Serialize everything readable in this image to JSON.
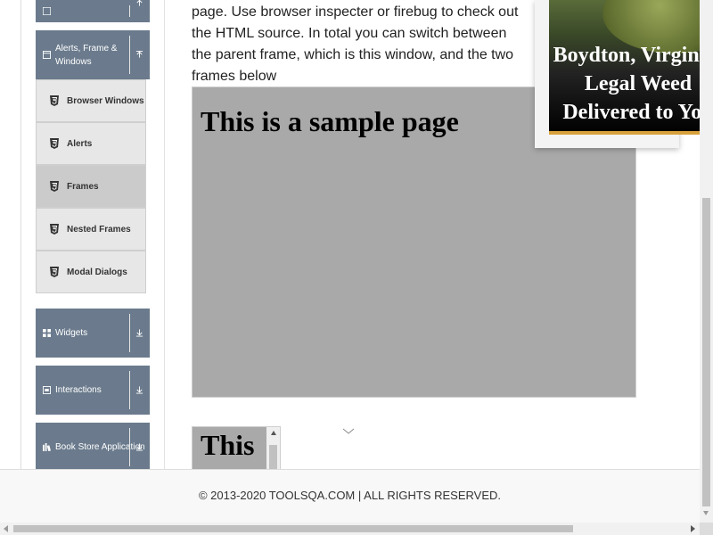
{
  "sidebar": {
    "groups": [
      {
        "label": "",
        "icon": "grid-icon",
        "arrow": "collapse-arrow-icon"
      },
      {
        "label": "Alerts, Frame & Windows",
        "icon": "window-icon",
        "arrow": "collapse-arrow-icon"
      },
      {
        "label": "Widgets",
        "icon": "widgets-icon",
        "arrow": "expand-arrow-icon"
      },
      {
        "label": "Interactions",
        "icon": "interactions-icon",
        "arrow": "expand-arrow-icon"
      },
      {
        "label": "Book Store Application",
        "icon": "bookstore-icon",
        "arrow": "expand-arrow-icon"
      }
    ],
    "items": [
      {
        "label": "Browser Windows",
        "icon": "html5-icon",
        "active": false
      },
      {
        "label": "Alerts",
        "icon": "html5-icon",
        "active": false
      },
      {
        "label": "Frames",
        "icon": "html5-icon",
        "active": true
      },
      {
        "label": "Nested Frames",
        "icon": "html5-icon",
        "active": false
      },
      {
        "label": "Modal Dialogs",
        "icon": "html5-icon",
        "active": false
      }
    ]
  },
  "main": {
    "intro_text": "page. Use browser inspecter or firebug to check out the HTML source. In total you can switch between the parent frame, which is this window, and the two frames below",
    "frame1_heading": "This is a sample page",
    "frame2_heading": "This is"
  },
  "ad": {
    "headline": "Boydton, Virginia: Legal Weed Delivered to You"
  },
  "footer": {
    "copyright": "© 2013-2020 TOOLSQA.COM | ALL RIGHTS RESERVED."
  },
  "colors": {
    "sidebar_group": "#6b7b8d",
    "sidebar_item": "#e7e7e7",
    "sidebar_item_active": "#cbcbcb",
    "frame_bg": "#a9a9a9",
    "ad_accent": "#d8a13c"
  }
}
